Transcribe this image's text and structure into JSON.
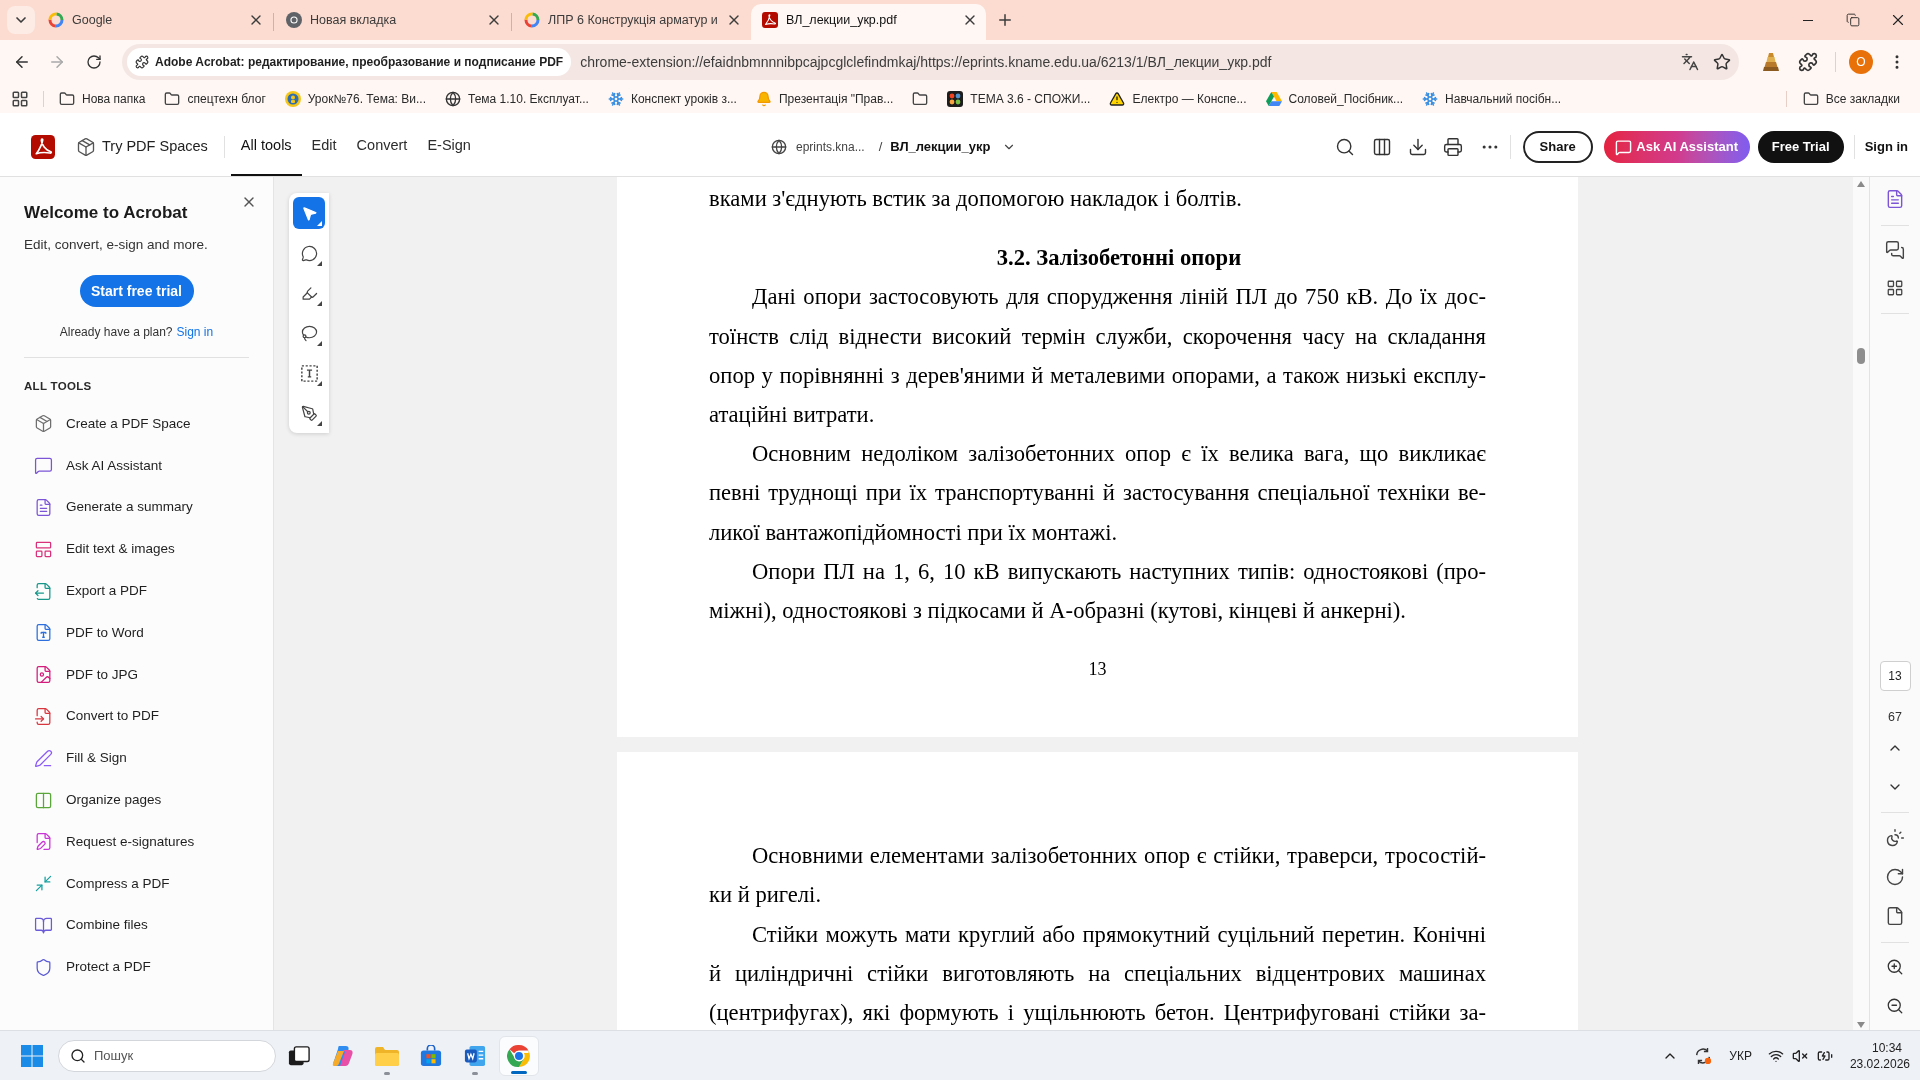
{
  "browser": {
    "tabs": [
      {
        "title": "Google",
        "selected": false
      },
      {
        "title": "Новая вкладка",
        "selected": false
      },
      {
        "title": "ЛПР 6 Конструкція арматур и",
        "selected": false
      },
      {
        "title": "ВЛ_лекции_укр.pdf",
        "selected": true
      }
    ],
    "site_chip": "Adobe Acrobat: редактирование, преобразование и подписание PDF",
    "url": "chrome-extension://efaidnbmnnnibpcajpcglclefindmkaj/https://eprints.kname.edu.ua/6213/1/ВЛ_лекции_укр.pdf",
    "profile_initial": "О",
    "bookmarks": [
      {
        "kind": "folder",
        "label": "Нова папка"
      },
      {
        "kind": "folder",
        "label": "спецтехн блог"
      },
      {
        "kind": "site",
        "label": "Урок№76. Тема: Ви..."
      },
      {
        "kind": "site",
        "label": "Тема 1.10. Експлуат..."
      },
      {
        "kind": "site",
        "label": "Конспект уроків з..."
      },
      {
        "kind": "site",
        "label": "Презентація \"Прав..."
      },
      {
        "kind": "folder"
      },
      {
        "kind": "site",
        "label": "ТЕМА 3.6 - СПОЖИ..."
      },
      {
        "kind": "site",
        "label": "Електро — Конспе..."
      },
      {
        "kind": "site",
        "label": "Соловей_Посібник..."
      },
      {
        "kind": "site",
        "label": "Навчальний посібн..."
      }
    ],
    "all_bookmarks": "Все закладки"
  },
  "acrobat": {
    "spaces_link": "Try PDF Spaces",
    "nav_tabs": [
      {
        "label": "All tools",
        "selected": true
      },
      {
        "label": "Edit",
        "selected": false
      },
      {
        "label": "Convert",
        "selected": false
      },
      {
        "label": "E-Sign",
        "selected": false
      }
    ],
    "breadcrumb": {
      "site": "eprints.kna...",
      "separator": "/",
      "file": "ВЛ_лекции_укр"
    },
    "share": "Share",
    "ai_assistant": "Ask AI Assistant",
    "free_trial": "Free Trial",
    "sign_in": "Sign in"
  },
  "sidebar": {
    "title": "Welcome to Acrobat",
    "subtitle": "Edit, convert, e-sign and more.",
    "cta": "Start free trial",
    "plan_prompt": "Already have a plan?",
    "sign_in": "Sign in",
    "section": "ALL TOOLS",
    "tools": [
      "Create a PDF Space",
      "Ask AI Assistant",
      "Generate a summary",
      "Edit text & images",
      "Export a PDF",
      "PDF to Word",
      "PDF to JPG",
      "Convert to PDF",
      "Fill & Sign",
      "Organize pages",
      "Request e-signatures",
      "Compress a PDF",
      "Combine files",
      "Protect a PDF"
    ]
  },
  "tool_rail": [
    {
      "selected": true
    },
    {
      "selected": false
    },
    {
      "selected": false
    },
    {
      "selected": false
    },
    {
      "selected": false
    },
    {
      "selected": false
    }
  ],
  "document": {
    "pages": [
      {
        "blocks": [
          {
            "kind": "paragraph",
            "continued": true,
            "runs_on": false,
            "lines": [
              "вками з'єднують встик за допомогою накладок і болтів."
            ]
          },
          {
            "kind": "heading",
            "text": "3.2. Залізобетонні опори"
          },
          {
            "kind": "paragraph",
            "continued": false,
            "runs_on": false,
            "lines": [
              "Дані опори застосовують для спорудження ліній ПЛ до 750 кВ. До їх дос-",
              "тоїнств слід віднести високий термін служби, скорочення часу на складання",
              "опор у порівнянні з дерев'яними й металевими опорами, а також низькі експлу-",
              "атаційні витрати."
            ]
          },
          {
            "kind": "paragraph",
            "continued": false,
            "runs_on": false,
            "lines": [
              "Основним недоліком залізобетонних опор є їх велика вага, що викликає",
              "певні труднощі при їх транспортуванні й застосування спеціальної техніки ве-",
              "ликої вантажопідйомності при їх монтажі."
            ]
          },
          {
            "kind": "paragraph",
            "continued": false,
            "runs_on": false,
            "lines": [
              "Опори ПЛ на 1, 6, 10 кВ випускають наступних типів: одностоякові (про-",
              "міжні), одностоякові з підкосами й А-образні (кутові, кінцеві й анкерні)."
            ]
          }
        ],
        "page_number": "13"
      },
      {
        "blocks": [
          {
            "kind": "paragraph",
            "continued": false,
            "runs_on": false,
            "lines": [
              "Основними елементами залізобетонних опор є стійки, траверси, тросостій-",
              "ки й ригелі."
            ]
          },
          {
            "kind": "paragraph",
            "continued": false,
            "runs_on": true,
            "lines": [
              "Стійки можуть мати круглий або прямокутний суцільний перетин. Конічні",
              "й циліндричні стійки виготовляють на спеціальних відцентрових машинах",
              "(центрифугах), які формують і ущільнюють бетон. Центрифуговані стійки за-"
            ]
          }
        ]
      }
    ]
  },
  "page_nav": {
    "current": "13",
    "total": "67"
  },
  "taskbar": {
    "search_placeholder": "Пошук",
    "apps": [
      {
        "running": false,
        "active": false
      },
      {
        "running": false,
        "active": false
      },
      {
        "running": true,
        "active": false
      },
      {
        "running": false,
        "active": false
      },
      {
        "running": true,
        "active": false
      },
      {
        "running": true,
        "active": true
      }
    ],
    "language": "УКР",
    "time": "10:34",
    "date": "23.02.2026"
  }
}
